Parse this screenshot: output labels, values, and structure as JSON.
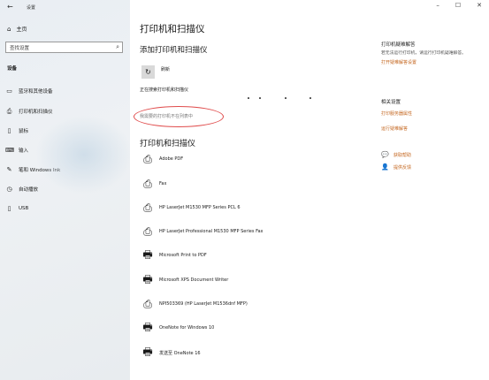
{
  "window": {
    "title": "设置",
    "back_icon": "←"
  },
  "sidebar": {
    "home_label": "主页",
    "search_placeholder": "查找设置",
    "section_label": "设备",
    "items": [
      {
        "label": "蓝牙和其他设备",
        "icon": "bluetooth-icon"
      },
      {
        "label": "打印机和扫描仪",
        "icon": "printer-icon"
      },
      {
        "label": "鼠标",
        "icon": "mouse-icon"
      },
      {
        "label": "输入",
        "icon": "keyboard-icon"
      },
      {
        "label": "笔和 Windows Ink",
        "icon": "pen-icon"
      },
      {
        "label": "自动播放",
        "icon": "autoplay-icon"
      },
      {
        "label": "USB",
        "icon": "usb-icon"
      }
    ]
  },
  "main": {
    "page_title": "打印机和扫描仪",
    "add_heading": "添加打印机和扫描仪",
    "refresh_label": "刷新",
    "searching_text": "正在搜索打印机和扫描仪",
    "not_listed_link": "我需要的打印机不在列表中",
    "list_heading": "打印机和扫描仪",
    "printers": [
      {
        "name": "Adobe PDF",
        "icon": "printer-icon"
      },
      {
        "name": "Fax",
        "icon": "printer-icon"
      },
      {
        "name": "HP LaserJet M1530 MFP Series PCL 6",
        "icon": "printer-icon"
      },
      {
        "name": "HP LaserJet Professional M1530 MFP Series Fax",
        "icon": "printer-icon"
      },
      {
        "name": "Microsoft Print to PDF",
        "icon": "document-printer-icon"
      },
      {
        "name": "Microsoft XPS Document Writer",
        "icon": "document-printer-icon"
      },
      {
        "name": "NPI503369 (HP LaserJet M1536dnf MFP)",
        "icon": "printer-icon"
      },
      {
        "name": "OneNote for Windows 10",
        "icon": "document-printer-icon"
      },
      {
        "name": "发送至 OneNote 16",
        "icon": "document-printer-icon"
      }
    ]
  },
  "aside": {
    "troubleshoot_heading": "打印机疑难解答",
    "troubleshoot_text": "若无法运行打印机，请运行打印机疑难解答。",
    "troubleshoot_link": "打开疑难解答设置",
    "related_heading": "相关设置",
    "print_server_link": "打印服务器属性",
    "run_troubleshooter_link": "运行疑难解答",
    "help_label": "获取帮助",
    "feedback_label": "提供反馈"
  },
  "colors": {
    "link": "#c4661f",
    "annotation": "#e04b4b"
  }
}
